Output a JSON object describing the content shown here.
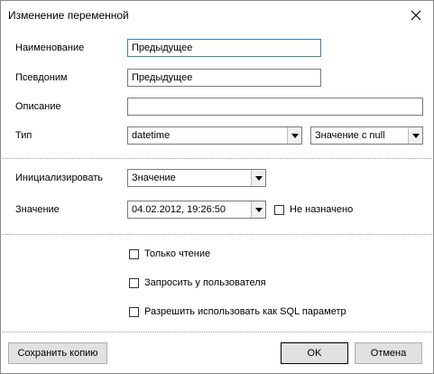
{
  "window": {
    "title": "Изменение переменной"
  },
  "form": {
    "name_label": "Наименование",
    "name_value": "Предыдущее",
    "alias_label": "Псевдоним",
    "alias_value": "Предыдущее",
    "description_label": "Описание",
    "description_value": "",
    "type_label": "Тип",
    "type_value": "datetime",
    "nullable_value": "Значение с null",
    "init_label": "Инициализировать",
    "init_value": "Значение",
    "value_label": "Значение",
    "value_value": "04.02.2012, 19:26:50",
    "not_assigned_label": "Не назначено",
    "not_assigned_checked": false
  },
  "options": [
    {
      "label": "Только чтение",
      "checked": false
    },
    {
      "label": "Запросить у пользователя",
      "checked": false
    },
    {
      "label": "Разрешить использовать как SQL параметр",
      "checked": false
    }
  ],
  "buttons": {
    "save_copy": "Сохранить копию",
    "ok": "OK",
    "cancel": "Отмена"
  },
  "icons": {
    "close": "close-icon",
    "dropdown": "chevron-down-icon"
  }
}
